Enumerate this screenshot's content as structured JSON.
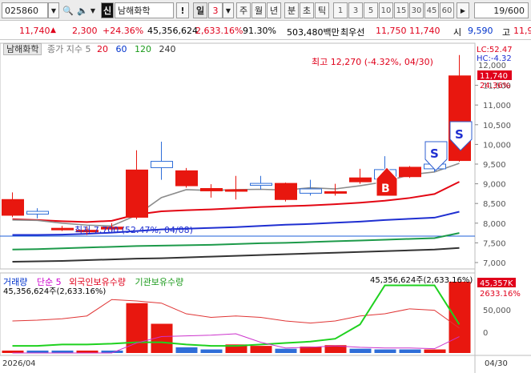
{
  "toolbar": {
    "code": "025860",
    "code_dropdown": "▼",
    "search_icon": "🔍",
    "speaker_icon": "🔈",
    "prefix_badge": "신",
    "stock_name": "남해화학",
    "info_button": "!",
    "period_selected": "일",
    "period_value": "3",
    "period_dropdown": "▼",
    "periods": [
      "주",
      "월",
      "년",
      "분",
      "초",
      "틱"
    ],
    "intervals": [
      "1",
      "3",
      "5",
      "10",
      "15",
      "30",
      "45",
      "60"
    ],
    "interval_more": "▶",
    "page_counter": "19/600"
  },
  "quote": {
    "price": "11,740",
    "arrow": "▲",
    "change": "2,300",
    "change_pct": "+24.36%",
    "volume": "45,356,624",
    "volume_pct": "2,633.16%",
    "ratio": "91.30%",
    "trade_value": "503,480백만",
    "best_bid_label": "최우선",
    "best_bid": "11,750",
    "best_ask": "11,740",
    "open_label": "시",
    "open": "9,590",
    "high_label": "고",
    "high": "11,9"
  },
  "main_chart": {
    "legend": {
      "name": "남해화학",
      "ma_label": "종가 지수 5",
      "ma20": "20",
      "ma60": "60",
      "ma120": "120",
      "ma240": "240"
    },
    "high_annotation": "최고 12,270 (-4.32%, 04/30)",
    "low_annotation": "최저 7,700 (52.47%, 04/08)",
    "top_right": {
      "lc": "LC:52.47",
      "hc": "HC:-4.32",
      "top_tick": "12,000"
    },
    "price_tag": "11,740",
    "price_tag_pct": "24.36%",
    "y_ticks": [
      "11,500",
      "11,000",
      "10,500",
      "10,000",
      "9,500",
      "9,000",
      "8,500",
      "8,000",
      "7,500",
      "7,000"
    ],
    "y_tick_values": [
      11500,
      11000,
      10500,
      10000,
      9500,
      9000,
      8500,
      8000,
      7500,
      7000
    ],
    "signals": {
      "buy": "B",
      "sell_1": "S",
      "sell_2": "S"
    }
  },
  "volume_chart": {
    "legend": {
      "volume": "거래량",
      "simple": "단순 5",
      "foreign": "외국인보유수량",
      "institution": "기관보유수량"
    },
    "left_annotation": "45,356,624주(2,633.16%)",
    "right_annotation": "45,356,624주(2,633.16%)",
    "value_tag": "45,357K",
    "value_tag_pct": "2633.16%",
    "y_ticks": [
      "50,000",
      "0"
    ]
  },
  "x_axis": {
    "left_label": "2026/04",
    "right_label": "04/30"
  },
  "chart_data": {
    "type": "candlestick",
    "title": "남해화학",
    "candles": [
      {
        "open": 8200,
        "close": 8600,
        "high": 8780,
        "low": 8150
      },
      {
        "open": 8300,
        "close": 8230,
        "high": 8380,
        "low": 8120
      },
      {
        "open": 7870,
        "close": 7870,
        "high": 7930,
        "low": 7800
      },
      {
        "open": 7800,
        "close": 7820,
        "high": 7920,
        "low": 7700
      },
      {
        "open": 7850,
        "close": 7900,
        "high": 8000,
        "low": 7800
      },
      {
        "open": 8150,
        "close": 9350,
        "high": 9850,
        "low": 8100
      },
      {
        "open": 9570,
        "close": 9410,
        "high": 10070,
        "low": 9100
      },
      {
        "open": 8950,
        "close": 9330,
        "high": 9400,
        "low": 8900
      },
      {
        "open": 8820,
        "close": 8880,
        "high": 8990,
        "low": 8650
      },
      {
        "open": 8850,
        "close": 8850,
        "high": 9200,
        "low": 8600
      },
      {
        "open": 9010,
        "close": 8960,
        "high": 9200,
        "low": 8850
      },
      {
        "open": 8600,
        "close": 9010,
        "high": 9030,
        "low": 8550
      },
      {
        "open": 8870,
        "close": 8760,
        "high": 9100,
        "low": 8700
      },
      {
        "open": 8800,
        "close": 8800,
        "high": 9000,
        "low": 8700
      },
      {
        "open": 9050,
        "close": 9150,
        "high": 9380,
        "low": 9000
      },
      {
        "open": 9360,
        "close": 9120,
        "high": 9700,
        "low": 9100
      },
      {
        "open": 9180,
        "close": 9420,
        "high": 9450,
        "low": 9150
      },
      {
        "open": 9500,
        "close": 9380,
        "high": 9700,
        "low": 9300
      },
      {
        "open": 9590,
        "close": 11740,
        "high": 12270,
        "low": 9560
      }
    ],
    "ma5": [
      8080,
      8070,
      8000,
      7950,
      7930,
      8200,
      8650,
      8850,
      8830,
      8850,
      8860,
      8840,
      8900,
      8870,
      8950,
      9050,
      9230,
      9300,
      9520
    ],
    "ma20": [
      8100,
      8080,
      8050,
      8030,
      8060,
      8220,
      8300,
      8330,
      8350,
      8380,
      8410,
      8430,
      8450,
      8480,
      8520,
      8570,
      8640,
      8740,
      9050
    ],
    "ma60": [
      7700,
      7700,
      7710,
      7730,
      7760,
      7800,
      7840,
      7860,
      7880,
      7900,
      7930,
      7960,
      7980,
      8010,
      8040,
      8080,
      8110,
      8140,
      8290
    ],
    "ma120": [
      7330,
      7340,
      7360,
      7380,
      7400,
      7420,
      7430,
      7440,
      7450,
      7470,
      7490,
      7500,
      7520,
      7540,
      7560,
      7580,
      7600,
      7620,
      7750
    ],
    "ma240": [
      7020,
      7030,
      7040,
      7060,
      7080,
      7100,
      7110,
      7130,
      7150,
      7170,
      7190,
      7210,
      7230,
      7250,
      7270,
      7290,
      7310,
      7330,
      7370
    ],
    "volume_fraction": [
      0.03,
      0.02,
      0.02,
      0.02,
      0.02,
      0.7,
      0.41,
      0.08,
      0.05,
      0.12,
      0.1,
      0.06,
      0.09,
      0.11,
      0.06,
      0.05,
      0.05,
      0.05,
      1.0
    ],
    "volume_up": [
      true,
      false,
      false,
      true,
      false,
      true,
      true,
      false,
      false,
      true,
      true,
      false,
      true,
      true,
      false,
      false,
      false,
      true,
      true
    ],
    "volume_ma5_fraction": [
      0.0,
      0.0,
      0.0,
      0.0,
      0.0,
      0.14,
      0.23,
      0.24,
      0.25,
      0.27,
      0.15,
      0.07,
      0.08,
      0.1,
      0.08,
      0.07,
      0.07,
      0.06,
      0.23
    ],
    "foreign_fraction": [
      0.45,
      0.46,
      0.48,
      0.52,
      0.75,
      0.73,
      0.7,
      0.55,
      0.5,
      0.52,
      0.5,
      0.45,
      0.42,
      0.45,
      0.52,
      0.55,
      0.62,
      0.6,
      0.35
    ],
    "institution_fraction": [
      0.1,
      0.1,
      0.12,
      0.12,
      0.13,
      0.15,
      0.15,
      0.12,
      0.1,
      0.1,
      0.12,
      0.14,
      0.16,
      0.2,
      0.4,
      0.95,
      0.95,
      0.95,
      0.4
    ],
    "colors": {
      "up": "#e8170f",
      "down": "#2f6ed8",
      "ma5": "#8c8c8c",
      "ma20": "#e30613",
      "ma60": "#1f2fd1",
      "ma120": "#1d9a4a",
      "ma240": "#333333",
      "foreign": "#e03535",
      "institution": "#1fd11f",
      "simple5": "#cc33cc",
      "baseline": "#1e5fd9"
    }
  }
}
